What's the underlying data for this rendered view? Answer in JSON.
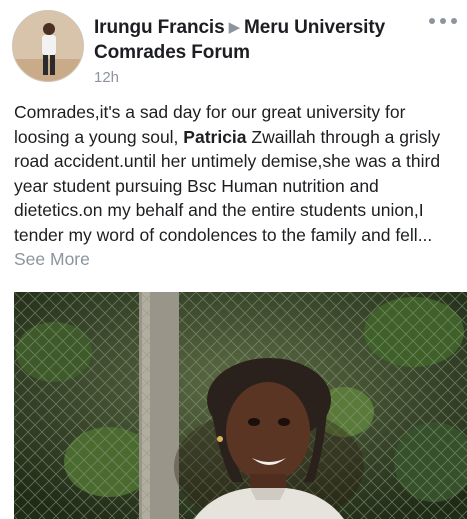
{
  "post": {
    "author": "Irungu Francis",
    "group": "Meru University Comrades Forum",
    "time": "12h",
    "text_before": "Comrades,it's a sad day for our great university for loosing a young soul, ",
    "text_bold": "Patricia",
    "text_after": " Zwaillah through a grisly road accident.until her untimely demise,she was a third year student pursuing Bsc Human nutrition and dietetics.on my behalf and the entire students union,I tender my word of condolences to the family and fell... ",
    "see_more": "See More"
  },
  "icons": {
    "arrow": "right-triangle-icon",
    "more": "three-dots-icon"
  },
  "colors": {
    "text": "#1c1e21",
    "meta": "#8d949e"
  }
}
